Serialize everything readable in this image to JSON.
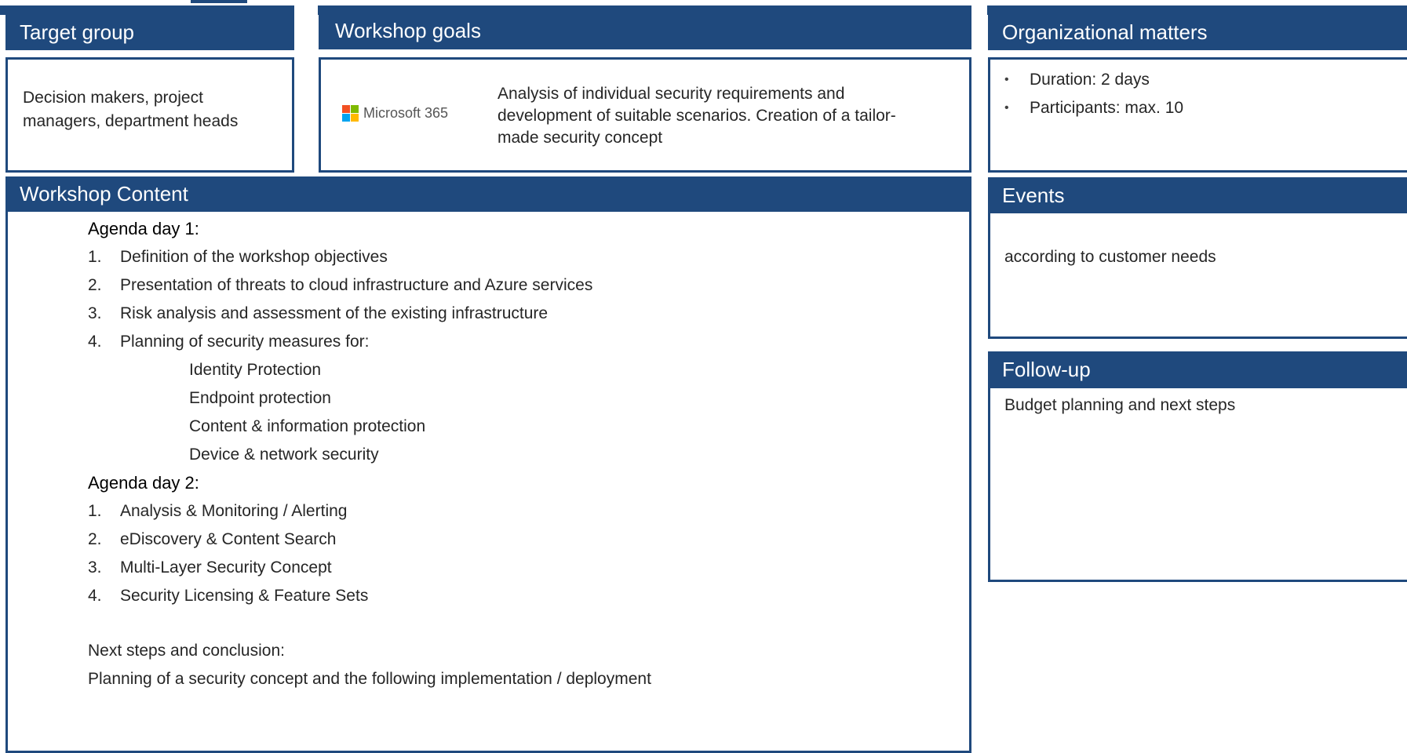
{
  "colors": {
    "accent": "#1f497d",
    "ms_red": "#f25022",
    "ms_green": "#7fba00",
    "ms_blue": "#00a4ef",
    "ms_yellow": "#ffb900"
  },
  "target_group": {
    "title": "Target group",
    "text_line1": "Decision makers, project",
    "text_line2": "managers, department heads"
  },
  "workshop_goals": {
    "title": "Workshop goals",
    "logo_text": "Microsoft 365",
    "logo_icon": "microsoft-logo-icon",
    "text_line1": "Analysis of individual security requirements and",
    "text_line2": "development of suitable scenarios. Creation of a tailor-",
    "text_line3": "made security concept"
  },
  "organizational": {
    "title": "Organizational matters",
    "items": [
      "Duration: 2 days",
      "Participants: max. 10"
    ]
  },
  "content": {
    "title": "Workshop Content",
    "day1_title": "Agenda day 1:",
    "day1_items": [
      {
        "num": "1.",
        "text": "Definition of the workshop objectives"
      },
      {
        "num": "2.",
        "text": "Presentation of threats to cloud infrastructure and Azure services"
      },
      {
        "num": "3.",
        "text": "Risk analysis and assessment of the existing infrastructure"
      },
      {
        "num": "4.",
        "text": "Planning of security measures for:"
      }
    ],
    "day1_subitems": [
      "Identity Protection",
      "Endpoint protection",
      "Content & information protection",
      "Device & network security"
    ],
    "day2_title": "Agenda day 2:",
    "day2_items": [
      {
        "num": "1.",
        "text": "Analysis & Monitoring / Alerting"
      },
      {
        "num": "2.",
        "text": "eDiscovery & Content Search"
      },
      {
        "num": "3.",
        "text": "Multi-Layer Security Concept"
      },
      {
        "num": "4.",
        "text": "Security Licensing & Feature Sets"
      }
    ],
    "next_steps_title": "Next steps and conclusion:",
    "next_steps_text": "Planning of a security concept and the following implementation / deployment"
  },
  "events": {
    "title": "Events",
    "text": "according to customer needs"
  },
  "follow_up": {
    "title": "Follow-up",
    "text": "Budget planning and next steps"
  }
}
